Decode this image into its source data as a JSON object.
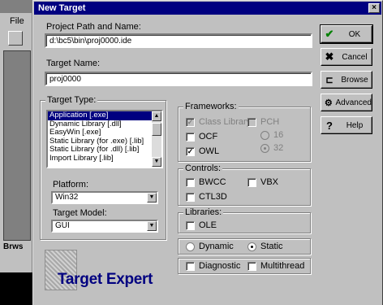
{
  "background_app": {
    "menu": "File",
    "pane_tab": "Brws"
  },
  "dialog": {
    "title": "New Target",
    "close_glyph": "×"
  },
  "project": {
    "label": "Project Path and Name:",
    "value": "d:\\bc5\\bin\\proj0000.ide"
  },
  "target_name": {
    "label": "Target Name:",
    "value": "proj0000"
  },
  "target_type": {
    "label": "Target Type:",
    "items": [
      "Application [.exe]",
      "Dynamic Library [.dll]",
      "EasyWin [.exe]",
      "Static Library (for .exe) [.lib]",
      "Static Library (for .dll) [.lib]",
      "Import Library [.lib]"
    ],
    "selected_index": 0
  },
  "platform": {
    "label": "Platform:",
    "value": "Win32"
  },
  "target_model": {
    "label": "Target Model:",
    "value": "GUI"
  },
  "frameworks": {
    "title": "Frameworks:",
    "class_library": "Class Library",
    "pch": "PCH",
    "ocf": "OCF",
    "owl": "OWL",
    "r16": "16",
    "r32": "32"
  },
  "controls": {
    "title": "Controls:",
    "bwcc": "BWCC",
    "vbx": "VBX",
    "ctl3d": "CTL3D"
  },
  "libraries": {
    "title": "Libraries:",
    "ole": "OLE"
  },
  "linking": {
    "dynamic": "Dynamic",
    "static": "Static"
  },
  "options": {
    "diagnostic": "Diagnostic",
    "multithread": "Multithread"
  },
  "buttons": {
    "ok": {
      "label": "OK",
      "icon": "check-icon"
    },
    "cancel": {
      "label": "Cancel",
      "icon": "x-icon"
    },
    "browse": {
      "label": "Browse",
      "icon": "folder-icon"
    },
    "advanced": {
      "label": "Advanced",
      "icon": "advanced-icon"
    },
    "help": {
      "label": "Help",
      "icon": "question-icon"
    }
  },
  "logo": "Target Expert",
  "colors": {
    "title_bar": "#000080",
    "selection": "#000080",
    "ok_check": "#008000",
    "dialog_face": "#c0c0c0"
  }
}
